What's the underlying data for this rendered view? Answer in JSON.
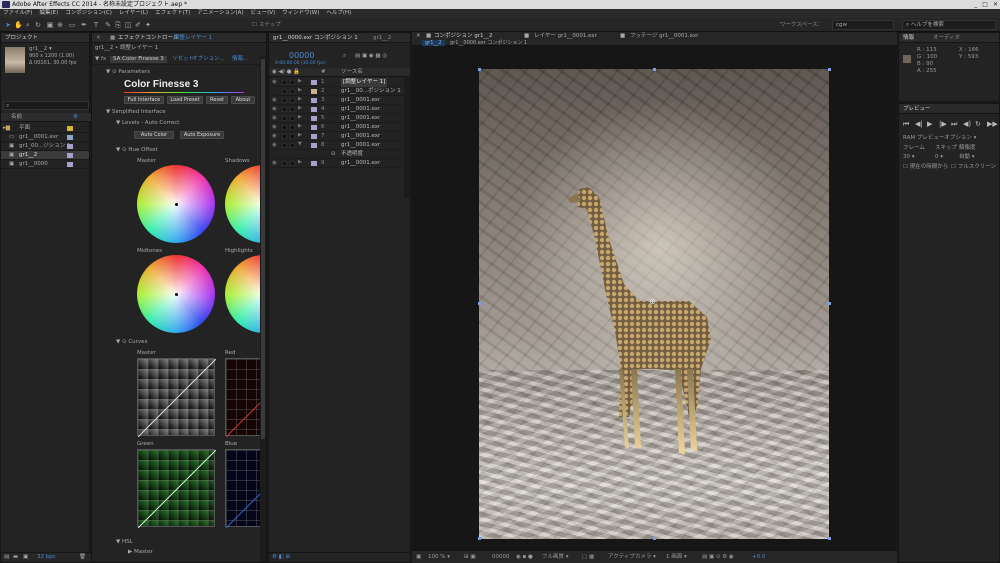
{
  "window": {
    "title": "Adobe After Effects CC 2014 - 名称未設定プロジェクト.aep *",
    "controls": [
      "_",
      "□",
      "✕"
    ]
  },
  "menu": [
    "ファイル(F)",
    "編集(E)",
    "コンポジション(C)",
    "レイヤー(L)",
    "エフェクト(T)",
    "アニメーション(A)",
    "ビュー(V)",
    "ウィンドウ(W)",
    "ヘルプ(H)"
  ],
  "toolbar": {
    "snap_label": "スナップ",
    "workspace_label": "ワークスペース：",
    "workspace_value": "cgw",
    "help_search_placeholder": "ヘルプを検索"
  },
  "project": {
    "tab": "プロジェクト",
    "thumb_name": "gr1__2 ▾",
    "thumb_info1": "900 x 1200 (1.00)",
    "thumb_info2": "Δ 00101, 30.00 fps",
    "search_placeholder": "",
    "col_name": "名前",
    "items": [
      "平面",
      "gr1__0001.exr",
      "gr1_00...ジション 1",
      "gr1__2",
      "gr1__0000"
    ],
    "bpc": "32 bpc"
  },
  "effects": {
    "tab": "エフェクトコントロール",
    "tab_target": "調整レイヤー 1",
    "breadcrumb": "gr1__2 • 調整レイヤー 1",
    "plugin": "SA Color Finesse 3",
    "reset": "リセット",
    "options": "オプション...",
    "info": "情報...",
    "parameters": "Parameters",
    "logo": "Color Finesse 3",
    "buttons": [
      "Full Interface",
      "Load Preset",
      "Reset",
      "About"
    ],
    "simplified": "Simplified Interface",
    "levels": "Levels - Auto Correct",
    "auto_color": "Auto Color",
    "auto_exposure": "Auto Exposure",
    "hue_offset": "Hue Offset",
    "master": "Master",
    "shadows": "Shadows",
    "midtones": "Midtones",
    "highlights": "Highlights",
    "curves": "Curves",
    "red": "Red",
    "green": "Green",
    "blue": "Blue",
    "hsl": "HSL"
  },
  "timeline": {
    "tabs": [
      "gr1__0000.exr コンポジション 1",
      "gr1__2"
    ],
    "timecode": "00000",
    "timecode_sub": "0:00:00:00 (30.00 fps)",
    "col_num": "#",
    "col_name": "ソース名",
    "layers": [
      {
        "n": "1",
        "name": "[調整レイヤー 1]"
      },
      {
        "n": "2",
        "name": "gr1__00...ポジション 1"
      },
      {
        "n": "3",
        "name": "gr1__0001.exr"
      },
      {
        "n": "4",
        "name": "gr1__0001.exr"
      },
      {
        "n": "5",
        "name": "gr1__0001.exr"
      },
      {
        "n": "6",
        "name": "gr1__0001.exr"
      },
      {
        "n": "7",
        "name": "gr1__0001.exr"
      },
      {
        "n": "8",
        "name": "gr1__0001.exr"
      },
      {
        "n": "",
        "name": "不透明度"
      },
      {
        "n": "9",
        "name": "gr1__0001.exr"
      }
    ]
  },
  "viewer": {
    "tabs": [
      "コンポジション gr1__2",
      "レイヤー gr1__0001.exr",
      "フッテージ gr1__0001.exr"
    ],
    "subtabs": [
      "gr1__2",
      "gr1__0000.exr コンポジション 1"
    ],
    "zoom": "100 %",
    "time": "00000",
    "quality": "フル画質",
    "camera": "アクティブカメラ",
    "views": "1 画面",
    "offset": "+0.0"
  },
  "info": {
    "tabs": [
      "情報",
      "オーディオ"
    ],
    "r": "R : 113",
    "g": "G : 100",
    "b": "B : 90",
    "a": "A : 255",
    "x": "X : 166",
    "y": "Y : 593"
  },
  "preview": {
    "tab": "プレビュー",
    "ram": "RAM プレビューオプション",
    "frame_label": "フレーム",
    "skip_label": "スキップ",
    "res_label": "解像度",
    "frame": "30",
    "skip": "0",
    "res": "自動",
    "opt1": "現在の時間から",
    "opt2": "フルスクリーン"
  }
}
